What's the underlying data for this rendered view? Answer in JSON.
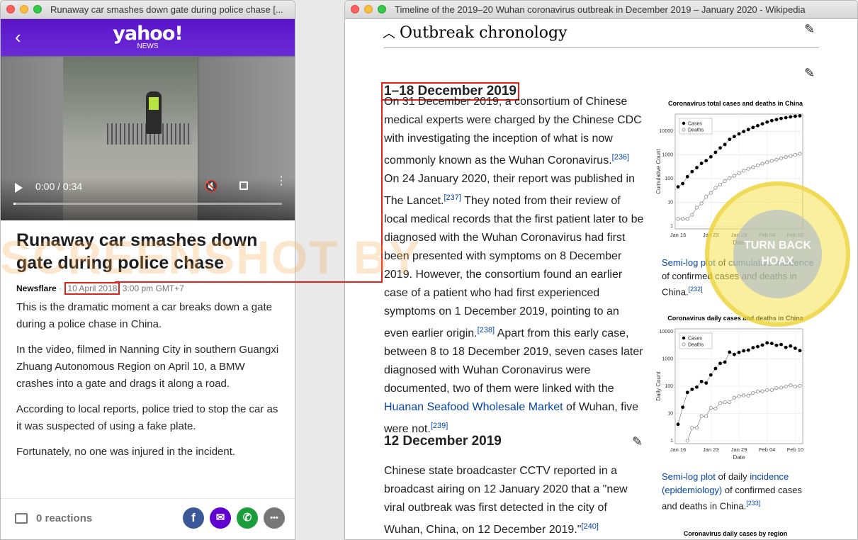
{
  "left_window": {
    "title": "Runaway car smashes down gate during police chase [...",
    "header": {
      "back": "‹",
      "logo": "yahoo!",
      "section": "NEWS"
    },
    "video": {
      "time": "0:00 / 0:34",
      "progress": 0.0
    },
    "article": {
      "title": "Runaway car smashes down gate during police chase",
      "source": "Newsflare",
      "sep": "·",
      "date": "10 April 2018",
      "time": "3:00 pm GMT+7",
      "paragraphs": [
        "This is the dramatic moment a car breaks down a gate during a police chase in China.",
        "In the video, filmed in Nanning City in southern Guangxi Zhuang Autonomous Region on April 10, a BMW crashes into a gate and drags it along a road.",
        "According to local reports, police tried to stop the car as it was suspected of using a fake plate.",
        "Fortunately, no one was injured in the incident."
      ]
    },
    "footer": {
      "reactions": "0 reactions",
      "share": [
        "facebook",
        "email",
        "whatsapp",
        "more"
      ],
      "share_glyphs": [
        "f",
        "✉",
        "✆",
        "•••"
      ]
    },
    "colors": {
      "header": "#5f01d1",
      "highlight": "#e0231b"
    }
  },
  "right_window": {
    "title": "Timeline of the 2019–20 Wuhan coronavirus outbreak in December 2019 – January 2020 - Wikipedia",
    "section_heading": "Outbreak chronology",
    "sub1": {
      "heading": "1–18 December 2019",
      "p1": "On 31 December 2019, a consortium of Chinese medical experts were charged by the Chinese CDC with investigating the inception of what is now commonly known as the Wuhan Coronavirus.",
      "ref1": "[236]",
      "p2": " On 24 January 2020, their report was published in The Lancet.",
      "ref2": "[237]",
      "p3": " They noted from their review of local medical records that the first patient later to be diagnosed with the Wuhan Coronavirus had first been presented with symptoms on 8 December 2019. However, the consortium found an earlier case of a patient who had first experienced symptoms on 1 December 2019, pointing to an even earlier origin.",
      "ref3": "[238]",
      "p4": " Apart from this early case, between 8 to 18 December 2019, seven cases later diagnosed with Wuhan Coronavirus were documented, two of them were linked with the ",
      "link": "Huanan Seafood Wholesale Market",
      "p5": " of Wuhan, five were not.",
      "ref4": "[239]"
    },
    "sub2": {
      "heading": "12 December 2019",
      "p1": "Chinese state broadcaster CCTV reported in a broadcast airing on 12 January 2020 that a \"new viral outbreak was first detected in the city of Wuhan, China, on 12 December 2019.\"",
      "ref": "[240]"
    },
    "caption1": {
      "link1": "Semi-log plot",
      "t1": " of ",
      "link2": "cumulative incidence",
      "t2": " of confirmed cases and deaths in China.",
      "ref": "[232]"
    },
    "caption2": {
      "link1": "Semi-log plot",
      "t1": " of daily ",
      "link2": "incidence (epidemiology)",
      "t2": " of confirmed cases and deaths in China.",
      "ref": "[233]"
    },
    "region_chart_title": "Coronavirus daily cases by region"
  },
  "chart_data": [
    {
      "type": "scatter",
      "title": "Coronavirus total cases and deaths in China",
      "xlabel": "Date",
      "ylabel": "Cumulative Count",
      "x_ticks": [
        "Jan 16",
        "Jan 23",
        "Jan 29",
        "Feb 04",
        "Feb 10"
      ],
      "y_ticks": [
        "1",
        "10",
        "100",
        "1000",
        "10000"
      ],
      "y_scale": "log",
      "ylim": [
        1,
        40000
      ],
      "legend": "top-left",
      "grid": true,
      "series": [
        {
          "name": "Cases",
          "marker": "filled",
          "x": [
            0,
            1,
            2,
            3,
            4,
            5,
            6,
            7,
            8,
            9,
            10,
            11,
            12,
            13,
            14,
            15,
            16,
            17,
            18,
            19,
            20,
            21,
            22,
            23,
            24,
            25,
            26
          ],
          "values": [
            45,
            62,
            121,
            198,
            291,
            440,
            571,
            830,
            1287,
            1975,
            2744,
            4515,
            5974,
            7711,
            9692,
            11791,
            14380,
            17205,
            20438,
            24324,
            28018,
            31161,
            34546,
            37198,
            40171,
            42638,
            44653
          ]
        },
        {
          "name": "Deaths",
          "marker": "open",
          "x": [
            0,
            1,
            2,
            3,
            4,
            5,
            6,
            7,
            8,
            9,
            10,
            11,
            12,
            13,
            14,
            15,
            16,
            17,
            18,
            19,
            20,
            21,
            22,
            23,
            24,
            25,
            26
          ],
          "values": [
            2,
            2,
            2,
            3,
            6,
            9,
            17,
            25,
            41,
            56,
            80,
            106,
            132,
            170,
            213,
            259,
            304,
            361,
            425,
            490,
            563,
            636,
            722,
            811,
            908,
            1016,
            1113
          ]
        }
      ]
    },
    {
      "type": "scatter",
      "title": "Coronavirus daily cases and deaths in China",
      "xlabel": "Date",
      "ylabel": "Daily Count",
      "x_ticks": [
        "Jan 16",
        "Jan 23",
        "Jan 29",
        "Feb 04",
        "Feb 10"
      ],
      "y_ticks": [
        "1",
        "10",
        "100",
        "1000",
        "10000"
      ],
      "y_scale": "log",
      "ylim": [
        1,
        10000
      ],
      "legend": "top-left",
      "grid": true,
      "series": [
        {
          "name": "Cases",
          "marker": "filled",
          "x": [
            0,
            1,
            2,
            3,
            4,
            5,
            6,
            7,
            8,
            9,
            10,
            11,
            12,
            13,
            14,
            15,
            16,
            17,
            18,
            19,
            20,
            21,
            22,
            23,
            24,
            25,
            26
          ],
          "values": [
            4,
            17,
            59,
            77,
            93,
            149,
            131,
            259,
            444,
            688,
            769,
            1771,
            1459,
            1737,
            1982,
            2102,
            2590,
            2829,
            3235,
            3887,
            3694,
            3143,
            3385,
            2652,
            2973,
            2467,
            2015
          ]
        },
        {
          "name": "Deaths",
          "marker": "open",
          "x": [
            2,
            3,
            4,
            5,
            6,
            7,
            8,
            9,
            10,
            11,
            12,
            13,
            14,
            15,
            16,
            17,
            18,
            19,
            20,
            21,
            22,
            23,
            24,
            25,
            26
          ],
          "values": [
            1,
            3,
            3,
            8,
            8,
            16,
            15,
            24,
            26,
            26,
            38,
            43,
            46,
            45,
            57,
            64,
            65,
            73,
            73,
            86,
            89,
            97,
            108,
            97,
            103
          ]
        }
      ]
    }
  ],
  "overlay": {
    "watermark": "SCREENSHOT BY",
    "seal": "TURN BACK HOAX"
  }
}
